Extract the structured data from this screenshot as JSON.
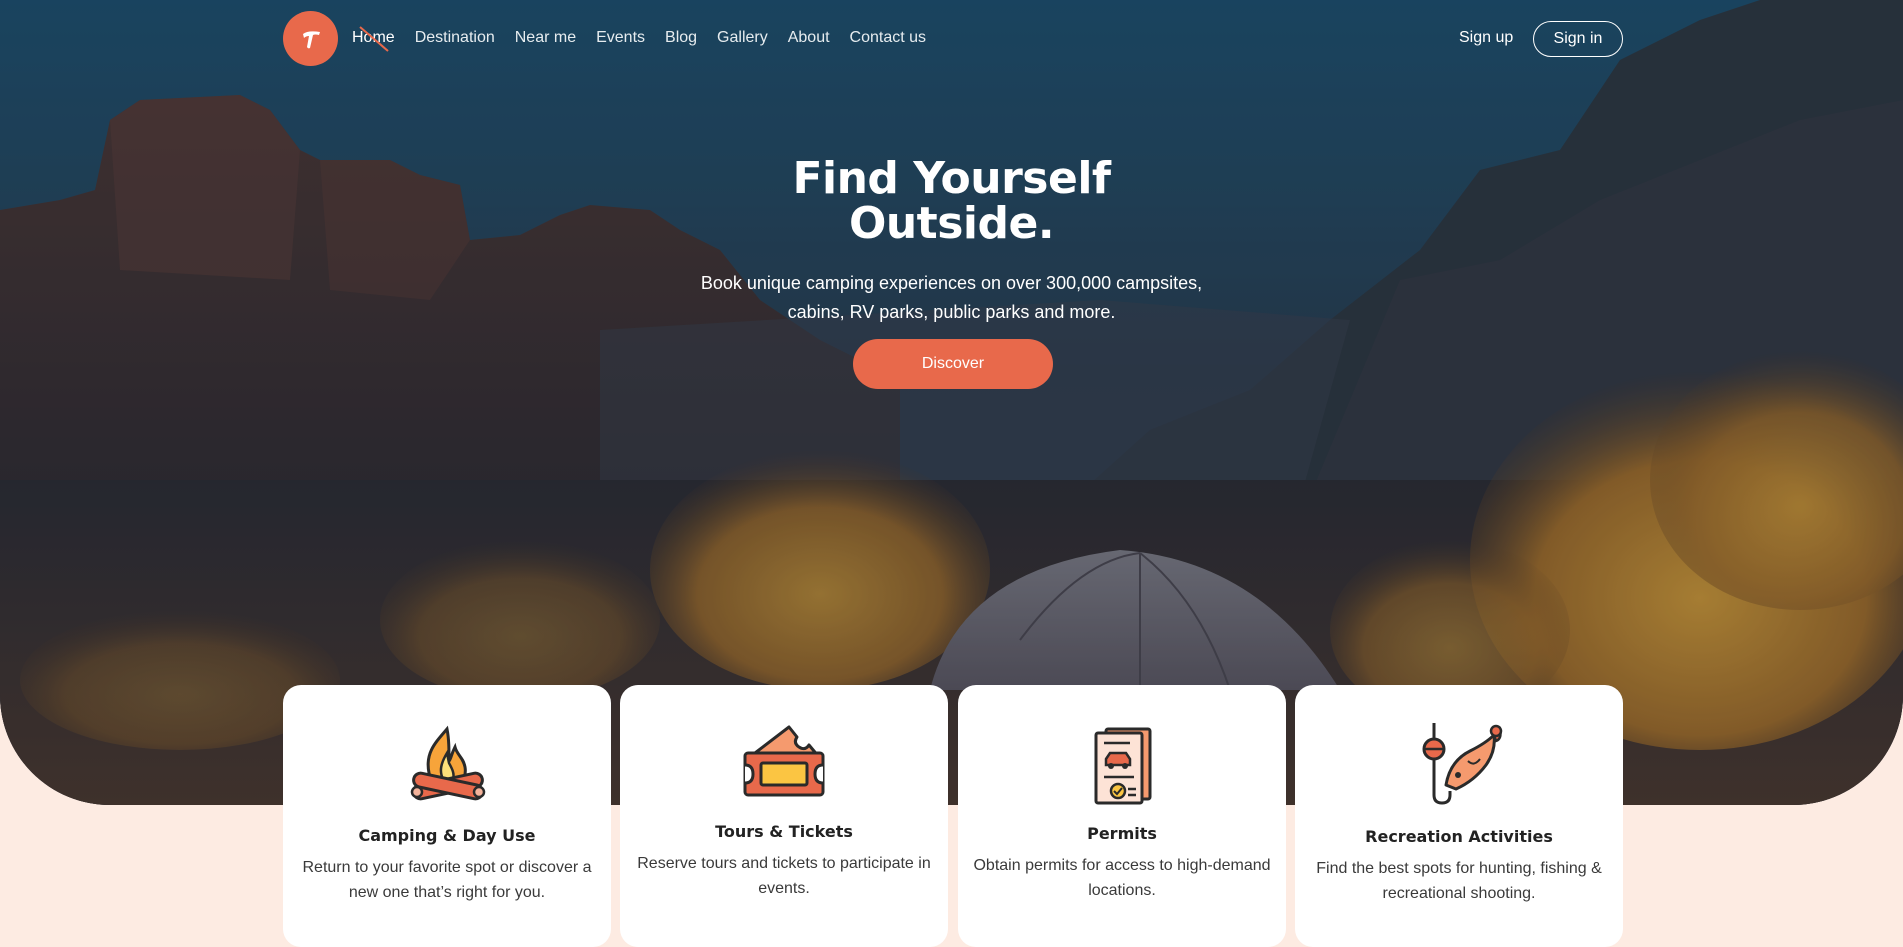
{
  "nav": {
    "links": [
      {
        "label": "Home"
      },
      {
        "label": "Destination"
      },
      {
        "label": "Near me"
      },
      {
        "label": "Events"
      },
      {
        "label": "Blog"
      },
      {
        "label": "Gallery"
      },
      {
        "label": "About"
      },
      {
        "label": "Contact us"
      }
    ],
    "sign_up": "Sign up",
    "sign_in": "Sign in"
  },
  "hero": {
    "title_line1": "Find Yourself",
    "title_line2": "Outside.",
    "subtitle_line1": "Book unique camping experiences on over 300,000 campsites,",
    "subtitle_line2": "cabins, RV parks, public parks and more.",
    "cta": "Discover"
  },
  "cards": [
    {
      "icon": "campfire-icon",
      "title": "Camping & Day Use",
      "desc": "Return to your favorite spot or discover a new one that’s right for you."
    },
    {
      "icon": "tickets-icon",
      "title": "Tours & Tickets",
      "desc": "Reserve tours and tickets to participate in events."
    },
    {
      "icon": "permit-document-icon",
      "title": "Permits",
      "desc": "Obtain permits for access to high-demand locations."
    },
    {
      "icon": "fishing-icon",
      "title": "Recreation Activities",
      "desc": "Find the best spots for hunting, fishing & recreational shooting."
    }
  ],
  "colors": {
    "accent": "#e8694b",
    "page_background": "#fdebe2",
    "card_background": "#ffffff",
    "title_text": "#222222"
  }
}
